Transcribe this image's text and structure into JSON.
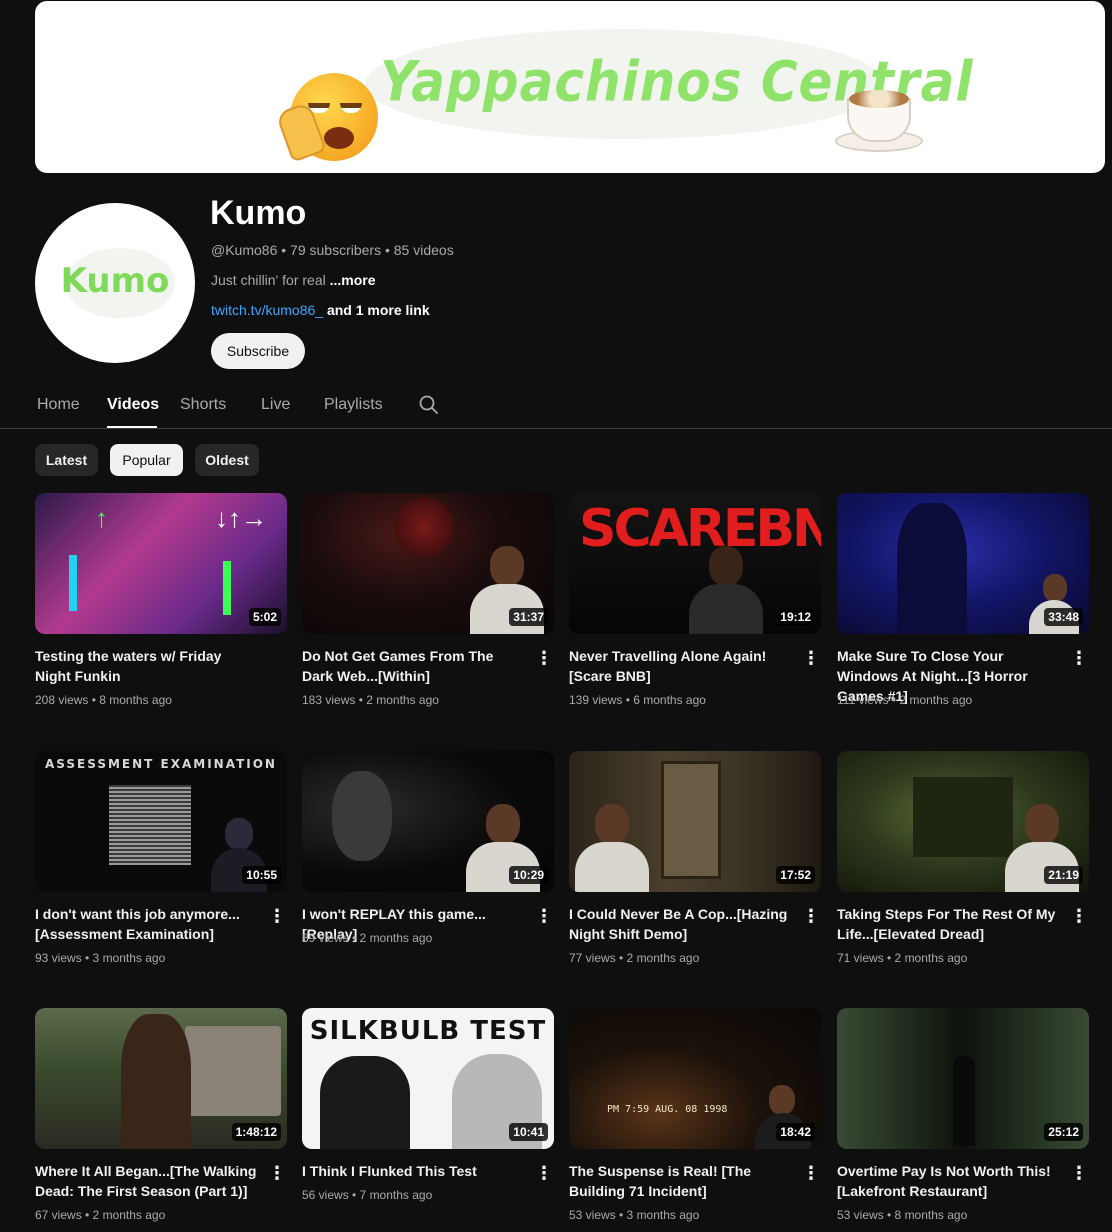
{
  "banner": {
    "title": "Yappachinos Central"
  },
  "avatar": {
    "text": "Kumo"
  },
  "channel": {
    "name": "Kumo",
    "meta": "@Kumo86 • 79 subscribers • 85 videos",
    "description": "Just chillin' for real",
    "more": "...more",
    "link": "twitch.tv/kumo86_",
    "link_more": "and 1 more link",
    "subscribe": "Subscribe"
  },
  "tabs": [
    "Home",
    "Videos",
    "Shorts",
    "Live",
    "Playlists"
  ],
  "active_tab": "Videos",
  "chips": [
    "Latest",
    "Popular",
    "Oldest"
  ],
  "active_chip": "Popular",
  "colors": {
    "accent_link": "#3ea6ff",
    "background": "#0f0f0f"
  },
  "videos": [
    {
      "title": "Testing the waters w/ Friday Night Funkin",
      "meta": "208 views • 8 months ago",
      "duration": "5:02"
    },
    {
      "title": "Do Not Get Games From The Dark Web...[Within]",
      "meta": "183 views • 2 months ago",
      "duration": "31:37"
    },
    {
      "title": "Never Travelling Alone Again! [Scare BNB]",
      "meta": "139 views • 6 months ago",
      "duration": "19:12",
      "thumb_text": "SCAREBNB"
    },
    {
      "title": "Make Sure To Close Your Windows At Night...[3 Horror Games #1]",
      "meta": "111 views • 2 months ago",
      "duration": "33:48"
    },
    {
      "title": "I don't want this job anymore...[Assessment Examination]",
      "meta": "93 views • 3 months ago",
      "duration": "10:55",
      "thumb_text": "ASSESSMENT EXAMINATION"
    },
    {
      "title": "I won't REPLAY this game...[Replay]",
      "meta": "89 views • 2 months ago",
      "duration": "10:29"
    },
    {
      "title": "I Could Never Be A Cop...[Hazing Night Shift Demo]",
      "meta": "77 views • 2 months ago",
      "duration": "17:52"
    },
    {
      "title": "Taking Steps For The Rest Of My Life...[Elevated Dread]",
      "meta": "71 views • 2 months ago",
      "duration": "21:19"
    },
    {
      "title": "Where It All Began...[The Walking Dead: The First Season (Part 1)]",
      "meta": "67 views • 2 months ago",
      "duration": "1:48:12"
    },
    {
      "title": "I Think I Flunked This Test",
      "meta": "56 views • 7 months ago",
      "duration": "10:41",
      "thumb_text": "SILKBULB TEST"
    },
    {
      "title": "The Suspense is Real! [The Building 71 Incident]",
      "meta": "53 views • 3 months ago",
      "duration": "18:42",
      "thumb_text": "PM 7:59 AUG. 08 1998"
    },
    {
      "title": "Overtime Pay Is Not Worth This! [Lakefront Restaurant]",
      "meta": "53 views • 8 months ago",
      "duration": "25:12"
    }
  ]
}
